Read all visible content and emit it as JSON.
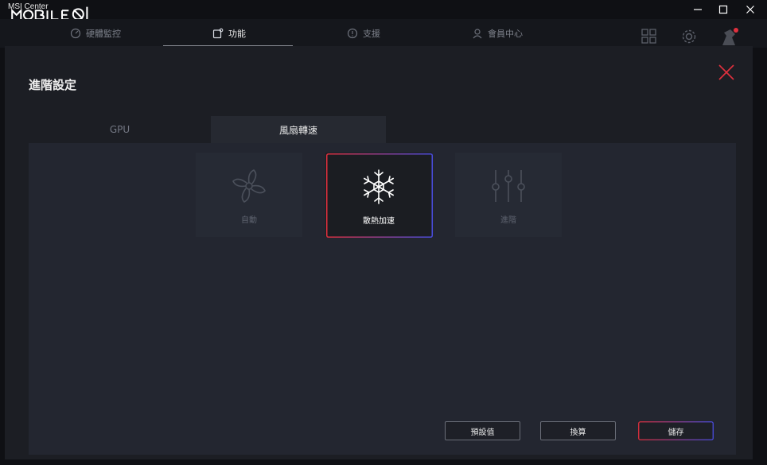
{
  "window": {
    "app_title": "MSI Center",
    "watermark": "MOBILE01"
  },
  "nav": {
    "tabs": [
      {
        "label": "硬體監控"
      },
      {
        "label": "功能"
      },
      {
        "label": "支援"
      },
      {
        "label": "會員中心"
      }
    ],
    "active_index": 1
  },
  "modal": {
    "title": "進階設定",
    "tabs": [
      {
        "label": "GPU"
      },
      {
        "label": "風扇轉速"
      }
    ],
    "active_tab": 1,
    "modes": [
      {
        "label": "自動",
        "icon": "fan-icon"
      },
      {
        "label": "散熱加速",
        "icon": "snowflake-icon",
        "selected": true
      },
      {
        "label": "進階",
        "icon": "sliders-icon"
      }
    ],
    "buttons": {
      "default": "預設值",
      "switch": "換算",
      "save": "儲存"
    }
  },
  "colors": {
    "accent_red": "#e0303e",
    "accent_blue": "#4a4de0"
  }
}
